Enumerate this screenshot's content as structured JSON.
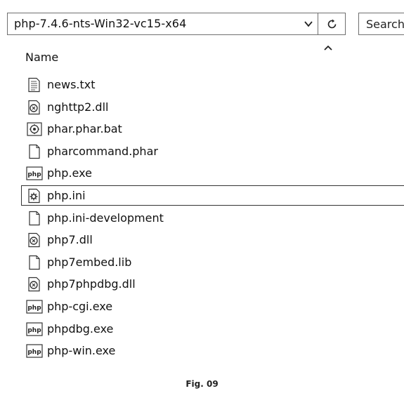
{
  "address_bar": {
    "path": "php-7.4.6-nts-Win32-vc15-x64",
    "dropdown_icon": "chevron-down-icon",
    "refresh_icon": "refresh-icon"
  },
  "search": {
    "placeholder": "Search"
  },
  "file_list": {
    "column_header": "Name",
    "sort_icon": "sort-ascending-icon",
    "items": [
      {
        "name": "news.txt",
        "icon": "text-file-icon",
        "selected": false
      },
      {
        "name": "nghttp2.dll",
        "icon": "dll-file-icon",
        "selected": false
      },
      {
        "name": "phar.phar.bat",
        "icon": "batch-file-icon",
        "selected": false
      },
      {
        "name": "pharcommand.phar",
        "icon": "blank-file-icon",
        "selected": false
      },
      {
        "name": "php.exe",
        "icon": "php-exe-icon",
        "selected": false
      },
      {
        "name": "php.ini",
        "icon": "settings-file-icon",
        "selected": true
      },
      {
        "name": "php.ini-development",
        "icon": "blank-file-icon",
        "selected": false
      },
      {
        "name": "php7.dll",
        "icon": "dll-file-icon",
        "selected": false
      },
      {
        "name": "php7embed.lib",
        "icon": "blank-file-icon",
        "selected": false
      },
      {
        "name": "php7phpdbg.dll",
        "icon": "dll-file-icon",
        "selected": false
      },
      {
        "name": "php-cgi.exe",
        "icon": "php-exe-icon",
        "selected": false
      },
      {
        "name": "phpdbg.exe",
        "icon": "php-exe-icon",
        "selected": false
      },
      {
        "name": "php-win.exe",
        "icon": "php-exe-icon",
        "selected": false
      }
    ]
  },
  "caption": "Fig. 09"
}
